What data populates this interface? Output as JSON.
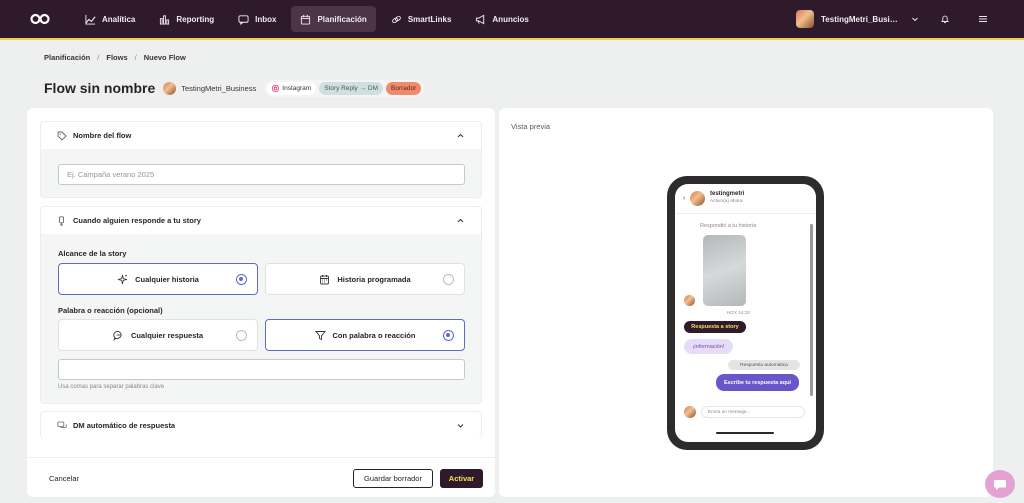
{
  "nav": {
    "items": [
      {
        "label": "Analítica",
        "icon": "chart-line-icon"
      },
      {
        "label": "Reporting",
        "icon": "bar-chart-icon"
      },
      {
        "label": "Inbox",
        "icon": "chat-icon"
      },
      {
        "label": "Planificación",
        "icon": "calendar-icon"
      },
      {
        "label": "SmartLinks",
        "icon": "link-icon"
      },
      {
        "label": "Anuncios",
        "icon": "megaphone-icon"
      }
    ],
    "account_name": "TestingMetri_Business"
  },
  "breadcrumb": [
    "Planificación",
    "Flows",
    "Nuevo Flow"
  ],
  "header": {
    "title": "Flow sin nombre",
    "account": "TestingMetri_Business",
    "badges": {
      "platform": "Instagram",
      "trigger": "Story Reply → DM",
      "status": "Borrador"
    }
  },
  "sections": {
    "name": {
      "title": "Nombre del flow",
      "placeholder": "Ej. Campaña verano 2025"
    },
    "trigger": {
      "title": "Cuando alguien responde a tu story",
      "scope_label": "Alcance de la story",
      "scope_options": [
        "Cualquier historia",
        "Historia programada"
      ],
      "keyword_label": "Palabra o reacción (opcional)",
      "keyword_options": [
        "Cualquier respuesta",
        "Con palabra o reacción"
      ],
      "hint": "Usa comas para separar palabras clave"
    },
    "dm": {
      "title": "DM automático de respuesta"
    }
  },
  "footer": {
    "cancel": "Cancelar",
    "save_draft": "Guardar borrador",
    "activate": "Activar"
  },
  "preview": {
    "label": "Vista previa",
    "chat_name": "testingmetri",
    "chat_status": "Activo(a) ahora",
    "replied_text": "Respondió a tu historia",
    "time": "HOY, 14:32",
    "story_reply": "Respuesta a story",
    "info_msg": "¡información!",
    "auto_label": "Respuesta automática",
    "auto_reply": "Escribe tu respuesta aquí",
    "compose_placeholder": "Envía un mensaje..."
  },
  "colors": {
    "nav_bg": "#2e1a2a",
    "accent_yellow": "#e9d24a",
    "selection": "#5f6ac4",
    "draft_badge": "#f08a6d"
  }
}
